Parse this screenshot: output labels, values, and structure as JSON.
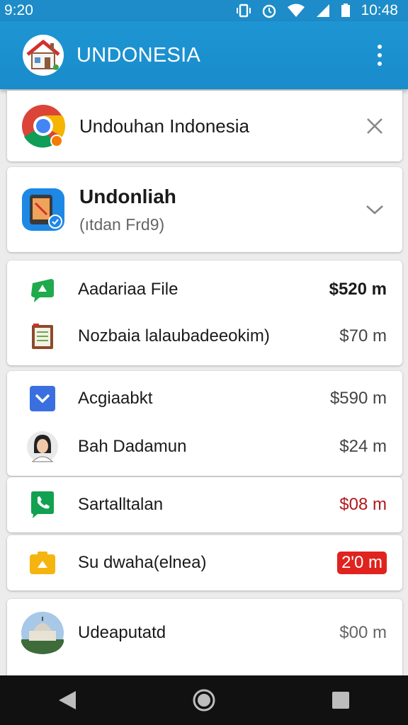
{
  "status_bar": {
    "time_left": "9:20",
    "time_right": "10:48"
  },
  "app_bar": {
    "title": "UNDONESIA",
    "logo_icon": "house-icon",
    "menu_icon": "more-vert-icon"
  },
  "notification": {
    "app": "chrome",
    "title": "Undouhan Indonesia",
    "dismiss_icon": "close-icon"
  },
  "download_card": {
    "title": "Undonliah",
    "subtitle": "(ıtdan Frd9)",
    "expand_icon": "chevron-down-icon"
  },
  "list_groups": [
    {
      "items": [
        {
          "icon": "chat-icon",
          "label": "Aadariaa File",
          "amount": "$520 m",
          "style": "bold"
        },
        {
          "icon": "notepad-icon",
          "label": "Nozbaia lalaubadeeokim)",
          "amount": "$70 m",
          "style": "normal"
        }
      ]
    },
    {
      "items": [
        {
          "icon": "mail-icon",
          "label": "Acgiaabkt",
          "amount": "$590 m",
          "style": "normal"
        },
        {
          "icon": "person-avatar",
          "label": "Bah Dadamun",
          "amount": "$24 m",
          "style": "normal"
        }
      ]
    },
    {
      "items": [
        {
          "icon": "phone-icon",
          "label": "Sartalltalan",
          "amount": "$08 m",
          "style": "red"
        }
      ]
    },
    {
      "items": [
        {
          "icon": "camera-icon",
          "label": "Su dwaha(elnea)",
          "amount": "2'0 m",
          "style": "badge"
        }
      ]
    },
    {
      "items": [
        {
          "icon": "building-icon",
          "label": "Udeaputatd",
          "amount": "$00 m",
          "style": "normal"
        }
      ]
    }
  ],
  "colors": {
    "primary": "#1d8cc8",
    "accent_red": "#e0231e",
    "nav_background": "#111111"
  },
  "nav_bar": {
    "back": "back-icon",
    "home": "home-icon",
    "recents": "recents-icon"
  }
}
